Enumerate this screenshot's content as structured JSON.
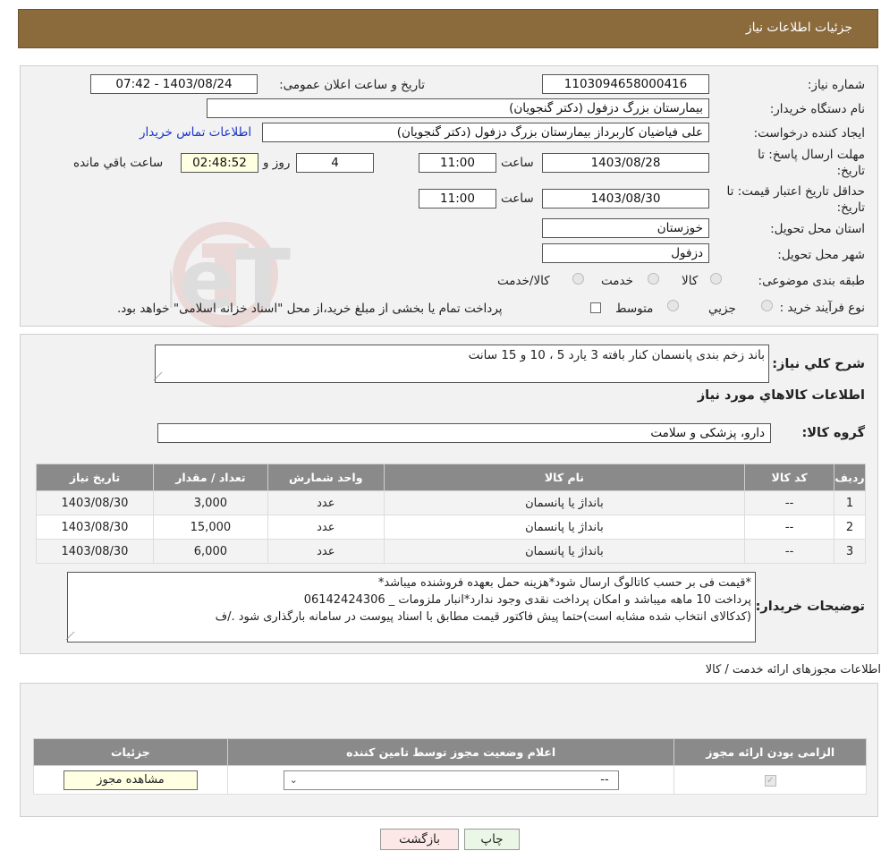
{
  "header": {
    "title": "جزئیات اطلاعات نیاز"
  },
  "need": {
    "number_label": "شماره نیاز:",
    "number": "1103094658000416",
    "announce_label": "تاریخ و ساعت اعلان عمومی:",
    "announce_value": "1403/08/24 - 07:42",
    "buyer_label": "نام دستگاه خریدار:",
    "buyer": "بیمارستان بزرگ دزفول (دکتر گنجویان)",
    "creator_label": "ایجاد کننده درخواست:",
    "creator": "علی فیاضیان کاربرداز بیمارستان بزرگ دزفول (دکتر گنجویان)",
    "contact_link": "اطلاعات تماس خریدار",
    "deadline_label_1": "مهلت ارسال پاسخ: تا",
    "deadline_label_2": "تاریخ:",
    "deadline_date": "1403/08/28",
    "time_label": "ساعت",
    "deadline_time": "11:00",
    "days_value": "4",
    "days_label": "روز و",
    "remaining_value": "02:48:52",
    "remaining_label": "ساعت باقي مانده",
    "validity_label_1": "حداقل تاریخ اعتبار قیمت: تا",
    "validity_label_2": "تاریخ:",
    "validity_date": "1403/08/30",
    "validity_time": "11:00",
    "province_label": "استان محل تحویل:",
    "province": "خوزستان",
    "city_label": "شهر محل تحویل:",
    "city": "دزفول",
    "category_label": "طبقه بندی موضوعی:",
    "category_options": [
      "کالا",
      "خدمت",
      "کالا/خدمت"
    ],
    "process_label": "نوع فرآیند خرید :",
    "process_options": [
      "جزیي",
      "متوسط"
    ],
    "process_note": "پرداخت تمام یا بخشی از مبلغ خرید،از محل \"اسناد خزانه اسلامی\" خواهد بود."
  },
  "details": {
    "summary_label": "شرح کلي نیاز:",
    "summary": "باند زخم بندی پانسمان کنار بافته 3 یارد 5 ، 10 و 15 سانت",
    "goods_title": "اطلاعات کالاهاي مورد نياز",
    "group_label": "گروه کالا:",
    "group": "دارو، پزشکی و سلامت",
    "table_headers": [
      "ردیف",
      "کد کالا",
      "نام کالا",
      "واحد شمارش",
      "تعداد / مقدار",
      "تاریخ نیاز"
    ],
    "rows": [
      [
        "1",
        "--",
        "بانداژ یا پانسمان",
        "عدد",
        "3,000",
        "1403/08/30"
      ],
      [
        "2",
        "--",
        "بانداژ یا پانسمان",
        "عدد",
        "15,000",
        "1403/08/30"
      ],
      [
        "3",
        "--",
        "بانداژ یا پانسمان",
        "عدد",
        "6,000",
        "1403/08/30"
      ]
    ],
    "notes_label": "توضیحات خریدار:",
    "notes_lines": [
      "*قیمت فی بر حسب کاتالوگ ارسال شود*هزینه حمل بعهده فروشنده میباشد*",
      "پرداخت 10 ماهه میباشد و امکان پرداخت نقدی وجود ندارد*انبار ملزومات _ 06142424306",
      "(کدکالای انتخاب شده مشابه است)حتما پیش فاکتور قیمت مطابق با اسناد پیوست در سامانه بارگذاری شود ./ف"
    ]
  },
  "permits": {
    "title": "اطلاعات مجوزهای ارائه خدمت / کالا",
    "headers": [
      "الزامی بودن ارائه مجوز",
      "اعلام وضعیت مجوز توسط تامین کننده",
      "جزئیات"
    ],
    "status_value": "--",
    "view_button": "مشاهده مجوز"
  },
  "actions": {
    "print": "چاپ",
    "back": "بازگشت"
  },
  "watermark": "AriaTender.neT",
  "colors": {
    "header": "#8b6a3c",
    "table_header": "#8a8a8a",
    "link": "#1a33c8"
  }
}
